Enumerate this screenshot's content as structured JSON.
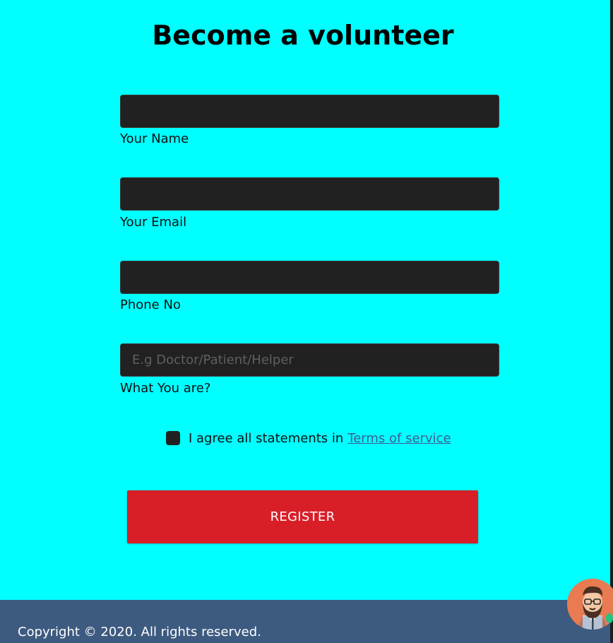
{
  "form": {
    "title": "Become a volunteer",
    "fields": [
      {
        "label": "Your Name",
        "value": "",
        "placeholder": ""
      },
      {
        "label": "Your Email",
        "value": "",
        "placeholder": ""
      },
      {
        "label": "Phone No",
        "value": "",
        "placeholder": ""
      },
      {
        "label": "What You are?",
        "value": "",
        "placeholder": "E.g Doctor/Patient/Helper"
      }
    ],
    "agree_text": "I agree all statements in",
    "terms_link": "Terms of service",
    "register_label": "REGISTER"
  },
  "footer": {
    "copyright": "Copyright © 2020. All rights reserved."
  },
  "icons": {
    "avatar": "user-avatar-icon",
    "online": "online-status-icon"
  },
  "colors": {
    "background": "#00ffff",
    "input_bg": "#212121",
    "register_button": "#d81f28",
    "footer_bg": "#3d5a80",
    "link": "#3d5f91",
    "online": "#26c281"
  }
}
